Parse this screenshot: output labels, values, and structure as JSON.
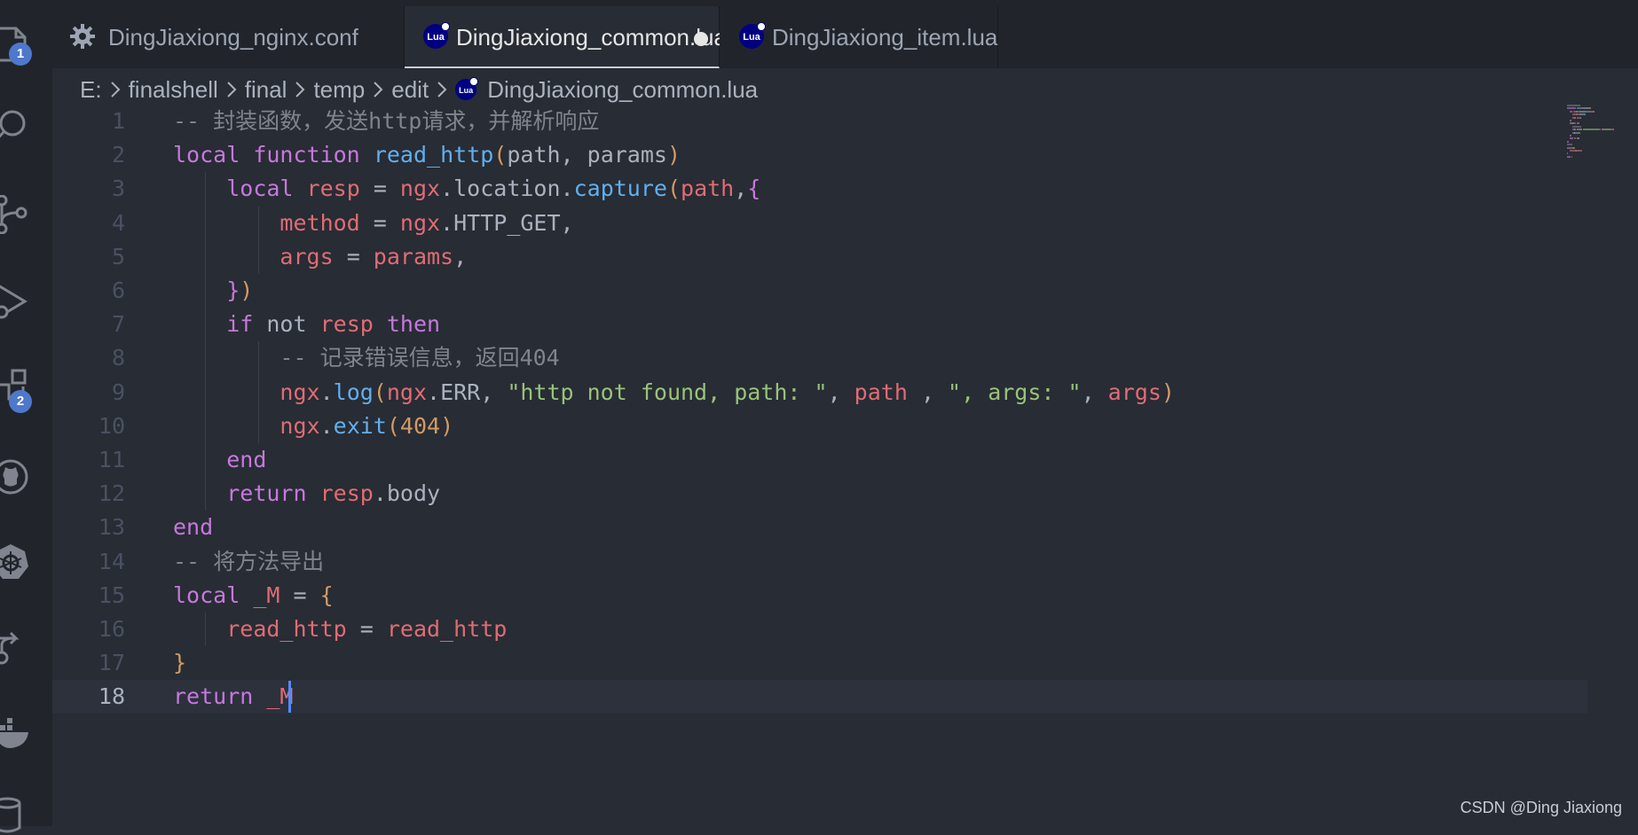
{
  "activity_bar": {
    "explorer_badge": "1",
    "extensions_badge": "2",
    "icons": [
      "files-icon",
      "search-icon",
      "source-control-icon",
      "run-debug-icon",
      "extensions-icon",
      "github-icon",
      "kubernetes-icon",
      "remote-explorer-icon",
      "docker-icon",
      "database-icon"
    ]
  },
  "tabs": [
    {
      "label": "DingJiaxiong_nginx.conf",
      "icon": "gear-icon",
      "active": false
    },
    {
      "label": "DingJiaxiong_common.lua",
      "icon": "lua-icon",
      "active": true,
      "modified": true
    },
    {
      "label": "DingJiaxiong_item.lua",
      "icon": "lua-icon",
      "active": false
    }
  ],
  "lua_icon_text": "Lua",
  "breadcrumb": [
    "E:",
    "finalshell",
    "final",
    "temp",
    "edit",
    "DingJiaxiong_common.lua"
  ],
  "editor": {
    "current_line": "18",
    "lines": [
      {
        "num": "1",
        "tokens": [
          {
            "t": "-- 封装函数，发送http请求，并解析响应",
            "c": "cmt"
          }
        ]
      },
      {
        "num": "2",
        "tokens": [
          {
            "t": "local",
            "c": "kw"
          },
          {
            "t": " ",
            "c": "plain"
          },
          {
            "t": "function",
            "c": "kw"
          },
          {
            "t": " ",
            "c": "plain"
          },
          {
            "t": "read_http",
            "c": "fn"
          },
          {
            "t": "(",
            "c": "br1"
          },
          {
            "t": "path, params",
            "c": "plain"
          },
          {
            "t": ")",
            "c": "br1"
          }
        ]
      },
      {
        "num": "3",
        "tokens": [
          {
            "t": "    ",
            "c": "plain"
          },
          {
            "t": "local",
            "c": "kw"
          },
          {
            "t": " ",
            "c": "plain"
          },
          {
            "t": "resp",
            "c": "var"
          },
          {
            "t": " = ",
            "c": "plain"
          },
          {
            "t": "ngx",
            "c": "var"
          },
          {
            "t": ".location.",
            "c": "plain"
          },
          {
            "t": "capture",
            "c": "fn"
          },
          {
            "t": "(",
            "c": "br1"
          },
          {
            "t": "path",
            "c": "var"
          },
          {
            "t": ",",
            "c": "plain"
          },
          {
            "t": "{",
            "c": "br2"
          }
        ]
      },
      {
        "num": "4",
        "tokens": [
          {
            "t": "        ",
            "c": "plain"
          },
          {
            "t": "method",
            "c": "var"
          },
          {
            "t": " = ",
            "c": "plain"
          },
          {
            "t": "ngx",
            "c": "var"
          },
          {
            "t": ".HTTP_GET,",
            "c": "plain"
          }
        ]
      },
      {
        "num": "5",
        "tokens": [
          {
            "t": "        ",
            "c": "plain"
          },
          {
            "t": "args",
            "c": "var"
          },
          {
            "t": " = ",
            "c": "plain"
          },
          {
            "t": "params",
            "c": "var"
          },
          {
            "t": ",",
            "c": "plain"
          }
        ]
      },
      {
        "num": "6",
        "tokens": [
          {
            "t": "    ",
            "c": "plain"
          },
          {
            "t": "}",
            "c": "br2"
          },
          {
            "t": ")",
            "c": "br1"
          }
        ]
      },
      {
        "num": "7",
        "tokens": [
          {
            "t": "    ",
            "c": "plain"
          },
          {
            "t": "if",
            "c": "kw"
          },
          {
            "t": " not ",
            "c": "plain"
          },
          {
            "t": "resp",
            "c": "var"
          },
          {
            "t": " ",
            "c": "plain"
          },
          {
            "t": "then",
            "c": "kw"
          }
        ]
      },
      {
        "num": "8",
        "tokens": [
          {
            "t": "        ",
            "c": "plain"
          },
          {
            "t": "-- 记录错误信息，返回404",
            "c": "cmt"
          }
        ]
      },
      {
        "num": "9",
        "tokens": [
          {
            "t": "        ",
            "c": "plain"
          },
          {
            "t": "ngx",
            "c": "var"
          },
          {
            "t": ".",
            "c": "plain"
          },
          {
            "t": "log",
            "c": "fn"
          },
          {
            "t": "(",
            "c": "br1"
          },
          {
            "t": "ngx",
            "c": "var"
          },
          {
            "t": ".ERR, ",
            "c": "plain"
          },
          {
            "t": "\"http not found, path: \"",
            "c": "str"
          },
          {
            "t": ", ",
            "c": "plain"
          },
          {
            "t": "path",
            "c": "var"
          },
          {
            "t": " , ",
            "c": "plain"
          },
          {
            "t": "\", args: \"",
            "c": "str"
          },
          {
            "t": ", ",
            "c": "plain"
          },
          {
            "t": "args",
            "c": "var"
          },
          {
            "t": ")",
            "c": "br1"
          }
        ]
      },
      {
        "num": "10",
        "tokens": [
          {
            "t": "        ",
            "c": "plain"
          },
          {
            "t": "ngx",
            "c": "var"
          },
          {
            "t": ".",
            "c": "plain"
          },
          {
            "t": "exit",
            "c": "fn"
          },
          {
            "t": "(",
            "c": "br1"
          },
          {
            "t": "404",
            "c": "num"
          },
          {
            "t": ")",
            "c": "br1"
          }
        ]
      },
      {
        "num": "11",
        "tokens": [
          {
            "t": "    ",
            "c": "plain"
          },
          {
            "t": "end",
            "c": "kw"
          }
        ]
      },
      {
        "num": "12",
        "tokens": [
          {
            "t": "    ",
            "c": "plain"
          },
          {
            "t": "return",
            "c": "kw"
          },
          {
            "t": " ",
            "c": "plain"
          },
          {
            "t": "resp",
            "c": "var"
          },
          {
            "t": ".body",
            "c": "plain"
          }
        ]
      },
      {
        "num": "13",
        "tokens": [
          {
            "t": "end",
            "c": "kw"
          }
        ]
      },
      {
        "num": "14",
        "tokens": [
          {
            "t": "-- 将方法导出",
            "c": "cmt"
          }
        ]
      },
      {
        "num": "15",
        "tokens": [
          {
            "t": "local",
            "c": "kw"
          },
          {
            "t": " ",
            "c": "plain"
          },
          {
            "t": "_M",
            "c": "var"
          },
          {
            "t": " = ",
            "c": "plain"
          },
          {
            "t": "{",
            "c": "br1"
          }
        ]
      },
      {
        "num": "16",
        "tokens": [
          {
            "t": "    ",
            "c": "plain"
          },
          {
            "t": "read_http",
            "c": "var"
          },
          {
            "t": " = ",
            "c": "plain"
          },
          {
            "t": "read_http",
            "c": "var"
          }
        ]
      },
      {
        "num": "17",
        "tokens": [
          {
            "t": "}",
            "c": "br1"
          }
        ]
      },
      {
        "num": "18",
        "tokens": [
          {
            "t": "return",
            "c": "kw"
          },
          {
            "t": " ",
            "c": "plain"
          },
          {
            "t": "_M",
            "c": "var"
          }
        ]
      }
    ]
  },
  "watermark": "CSDN @Ding Jiaxiong"
}
